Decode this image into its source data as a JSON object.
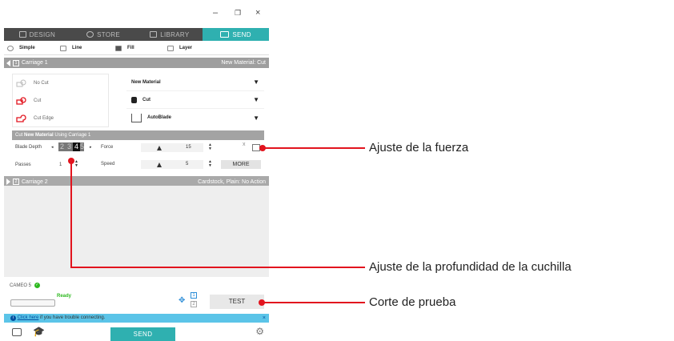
{
  "window": {
    "minimize": "–",
    "restore": "❐",
    "close": "×"
  },
  "tabs": [
    {
      "label": "DESIGN",
      "icon": "grid-icon"
    },
    {
      "label": "STORE",
      "icon": "store-icon"
    },
    {
      "label": "LIBRARY",
      "icon": "library-icon"
    },
    {
      "label": "SEND",
      "icon": "machine-icon"
    }
  ],
  "modes": [
    {
      "label": "Simple"
    },
    {
      "label": "Line"
    },
    {
      "label": "Fill"
    },
    {
      "label": "Layer"
    }
  ],
  "carriage1": {
    "title": "Carriage 1",
    "number": "1",
    "material": "New Material: Cut"
  },
  "actions": [
    {
      "label": "No Cut"
    },
    {
      "label": "Cut"
    },
    {
      "label": "Cut Edge"
    }
  ],
  "settings": {
    "material": "New Material",
    "action": "Cut",
    "tool": "AutoBlade"
  },
  "cutbar": {
    "prefix": "Cut",
    "material": "New Material",
    "suffix": "Using Carriage 1"
  },
  "blade": {
    "label": "Blade Depth",
    "values": [
      "2",
      "3",
      "4"
    ],
    "selected": "4",
    "suffix": "5"
  },
  "force": {
    "label": "Force",
    "value": "15"
  },
  "speed": {
    "label": "Speed",
    "value": "5"
  },
  "passes": {
    "label": "Passes",
    "value": "1"
  },
  "more_label": "MORE",
  "carriage2": {
    "title": "Carriage 2",
    "number": "2",
    "material": "Cardstock, Plain: No Action"
  },
  "device": {
    "name": "CAMEO 5",
    "status": "Ready"
  },
  "nav": {
    "num1": "1",
    "num2": "2"
  },
  "test_label": "TEST",
  "info": {
    "link": "Click here",
    "text": " if you have trouble connecting.",
    "close": "×"
  },
  "send_label": "SEND",
  "callouts": {
    "force": "Ajuste de la fuerza",
    "depth": "Ajuste de la profundidad de la cuchilla",
    "test": "Corte de prueba"
  },
  "colors": {
    "accent": "#2fb0b0",
    "callout": "#e2141e",
    "ready": "#2db81f"
  }
}
